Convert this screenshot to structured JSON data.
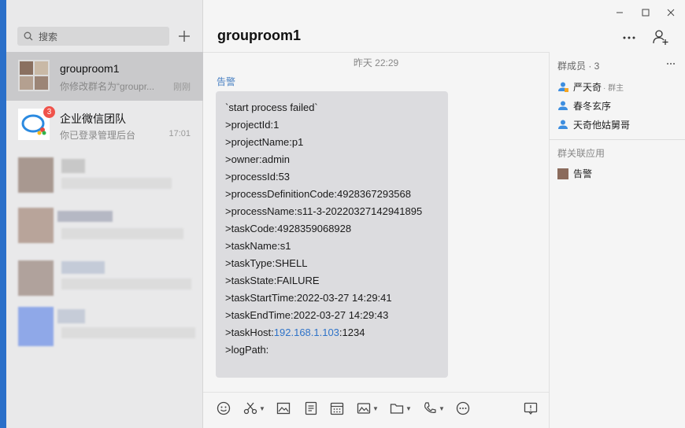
{
  "window": {
    "controls": [
      "minimize",
      "maximize",
      "close"
    ]
  },
  "sidebar": {
    "search_placeholder": "搜索",
    "conversations": [
      {
        "name": "grouproom1",
        "preview": "你修改群名为“groupr...",
        "time": "刚刚",
        "active": true
      },
      {
        "name": "企业微信团队",
        "preview": "你已登录管理后台",
        "time": "17:01",
        "badge": "3"
      }
    ]
  },
  "chat": {
    "title": "grouproom1",
    "timestamp": "昨天 22:29",
    "sender": "告警",
    "message_lines": [
      "`start process failed`",
      ">projectId:1",
      ">projectName:p1",
      ">owner:admin",
      ">processId:53",
      ">processDefinitionCode:4928367293568",
      ">processName:s11-3-20220327142941895",
      ">taskCode:4928359068928",
      ">taskName:s1",
      ">taskType:SHELL",
      ">taskState:FAILURE",
      ">taskStartTime:2022-03-27 14:29:41",
      ">taskEndTime:2022-03-27 14:29:43"
    ],
    "host_line": {
      "prefix": ">taskHost:",
      "ip": "192.168.1.103",
      "suffix": ":1234"
    },
    "last_line": ">logPath:",
    "toolbar_icons": [
      "emoji-icon",
      "scissors-icon",
      "image-icon",
      "document-icon",
      "calendar-icon",
      "photo-icon",
      "folder-icon",
      "phone-icon",
      "more-icon",
      "message-window-icon"
    ]
  },
  "members_panel": {
    "title": "群成员 · 3",
    "members": [
      {
        "name": "严天奇",
        "tag": "· 群主"
      },
      {
        "name": "春冬玄序",
        "tag": ""
      },
      {
        "name": "天奇他姑舅哥",
        "tag": ""
      }
    ],
    "apps_title": "群关联应用",
    "apps": [
      {
        "name": "告警"
      }
    ]
  },
  "colors": {
    "accent": "#2a6fc9",
    "link": "#2f73c8",
    "badge": "#f0534b",
    "bubble": "#dcdcdf"
  }
}
